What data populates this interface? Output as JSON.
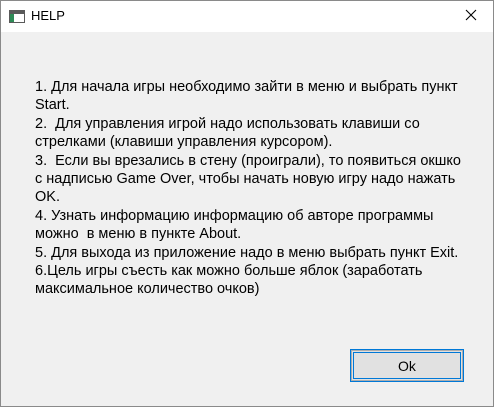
{
  "window": {
    "title": "HELP",
    "icon": "window-app-icon",
    "close_icon": "close-icon"
  },
  "help": {
    "lines": [
      "1. Для начала игры необходимо зайти в меню и выбрать пункт Start.",
      "2.  Для управления игрой надо использовать клавиши со стрелками (клавиши управления курсором).",
      "3.  Если вы врезались в стену (проиграли), то появиться окшко с надписью Game Over, чтобы начать новую игру надо нажать OK.",
      "4. Узнать информацию информацию об авторе программы можно  в меню в пункте About.",
      "5. Для выхода из приложение надо в меню выбрать пункт Exit.",
      "6.Цель игры съесть как можно больше яблок (заработать максимальное количество очков)"
    ]
  },
  "buttons": {
    "ok_label": "Ok"
  },
  "colors": {
    "titlebar": "#ffffff",
    "client_area": "#f0f0f0",
    "focus_accent": "#0078d7",
    "button_face": "#e1e1e1"
  }
}
